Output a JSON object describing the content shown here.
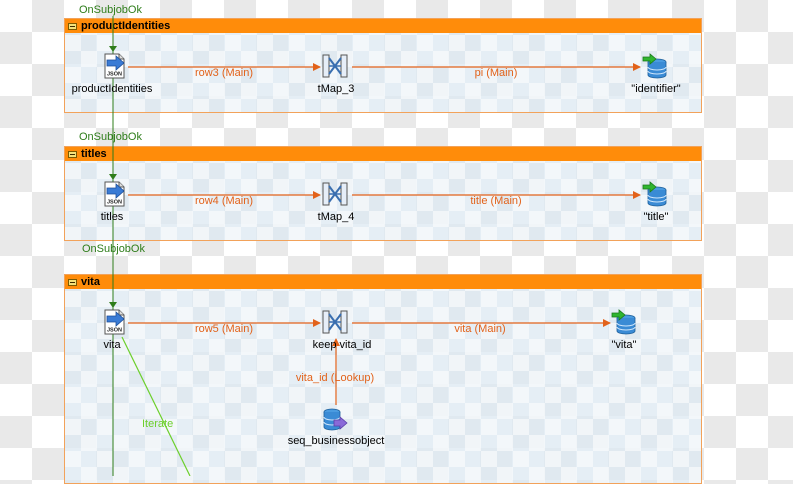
{
  "triggers": [
    "OnSubjobOk",
    "OnSubjobOk",
    "OnSubjobOk"
  ],
  "iterate_label": "Iterate",
  "subjobs": [
    {
      "title": "productIdentities",
      "components": [
        "productIdentities",
        "tMap_3",
        "\"identifier\""
      ],
      "links": [
        "row3 (Main)",
        "pi (Main)"
      ]
    },
    {
      "title": "titles",
      "components": [
        "titles",
        "tMap_4",
        "\"title\""
      ],
      "links": [
        "row4 (Main)",
        "title (Main)"
      ]
    },
    {
      "title": "vita",
      "components": [
        "vita",
        "keep vita_id",
        "\"vita\"",
        "seq_businessobject"
      ],
      "links": [
        "row5 (Main)",
        "vita (Main)",
        "vita_id (Lookup)"
      ]
    }
  ],
  "colors": {
    "header": "#ff8c0a",
    "main_link": "#e2621a",
    "trigger_link": "#2e7d1a",
    "iterate_link": "#6ccf2b"
  },
  "icons": {
    "json_input": "json-file-arrow-icon",
    "tmap": "tmap-cross-icon",
    "db_output": "database-green-arrow-icon",
    "db_lookup": "database-purple-arrow-icon"
  }
}
